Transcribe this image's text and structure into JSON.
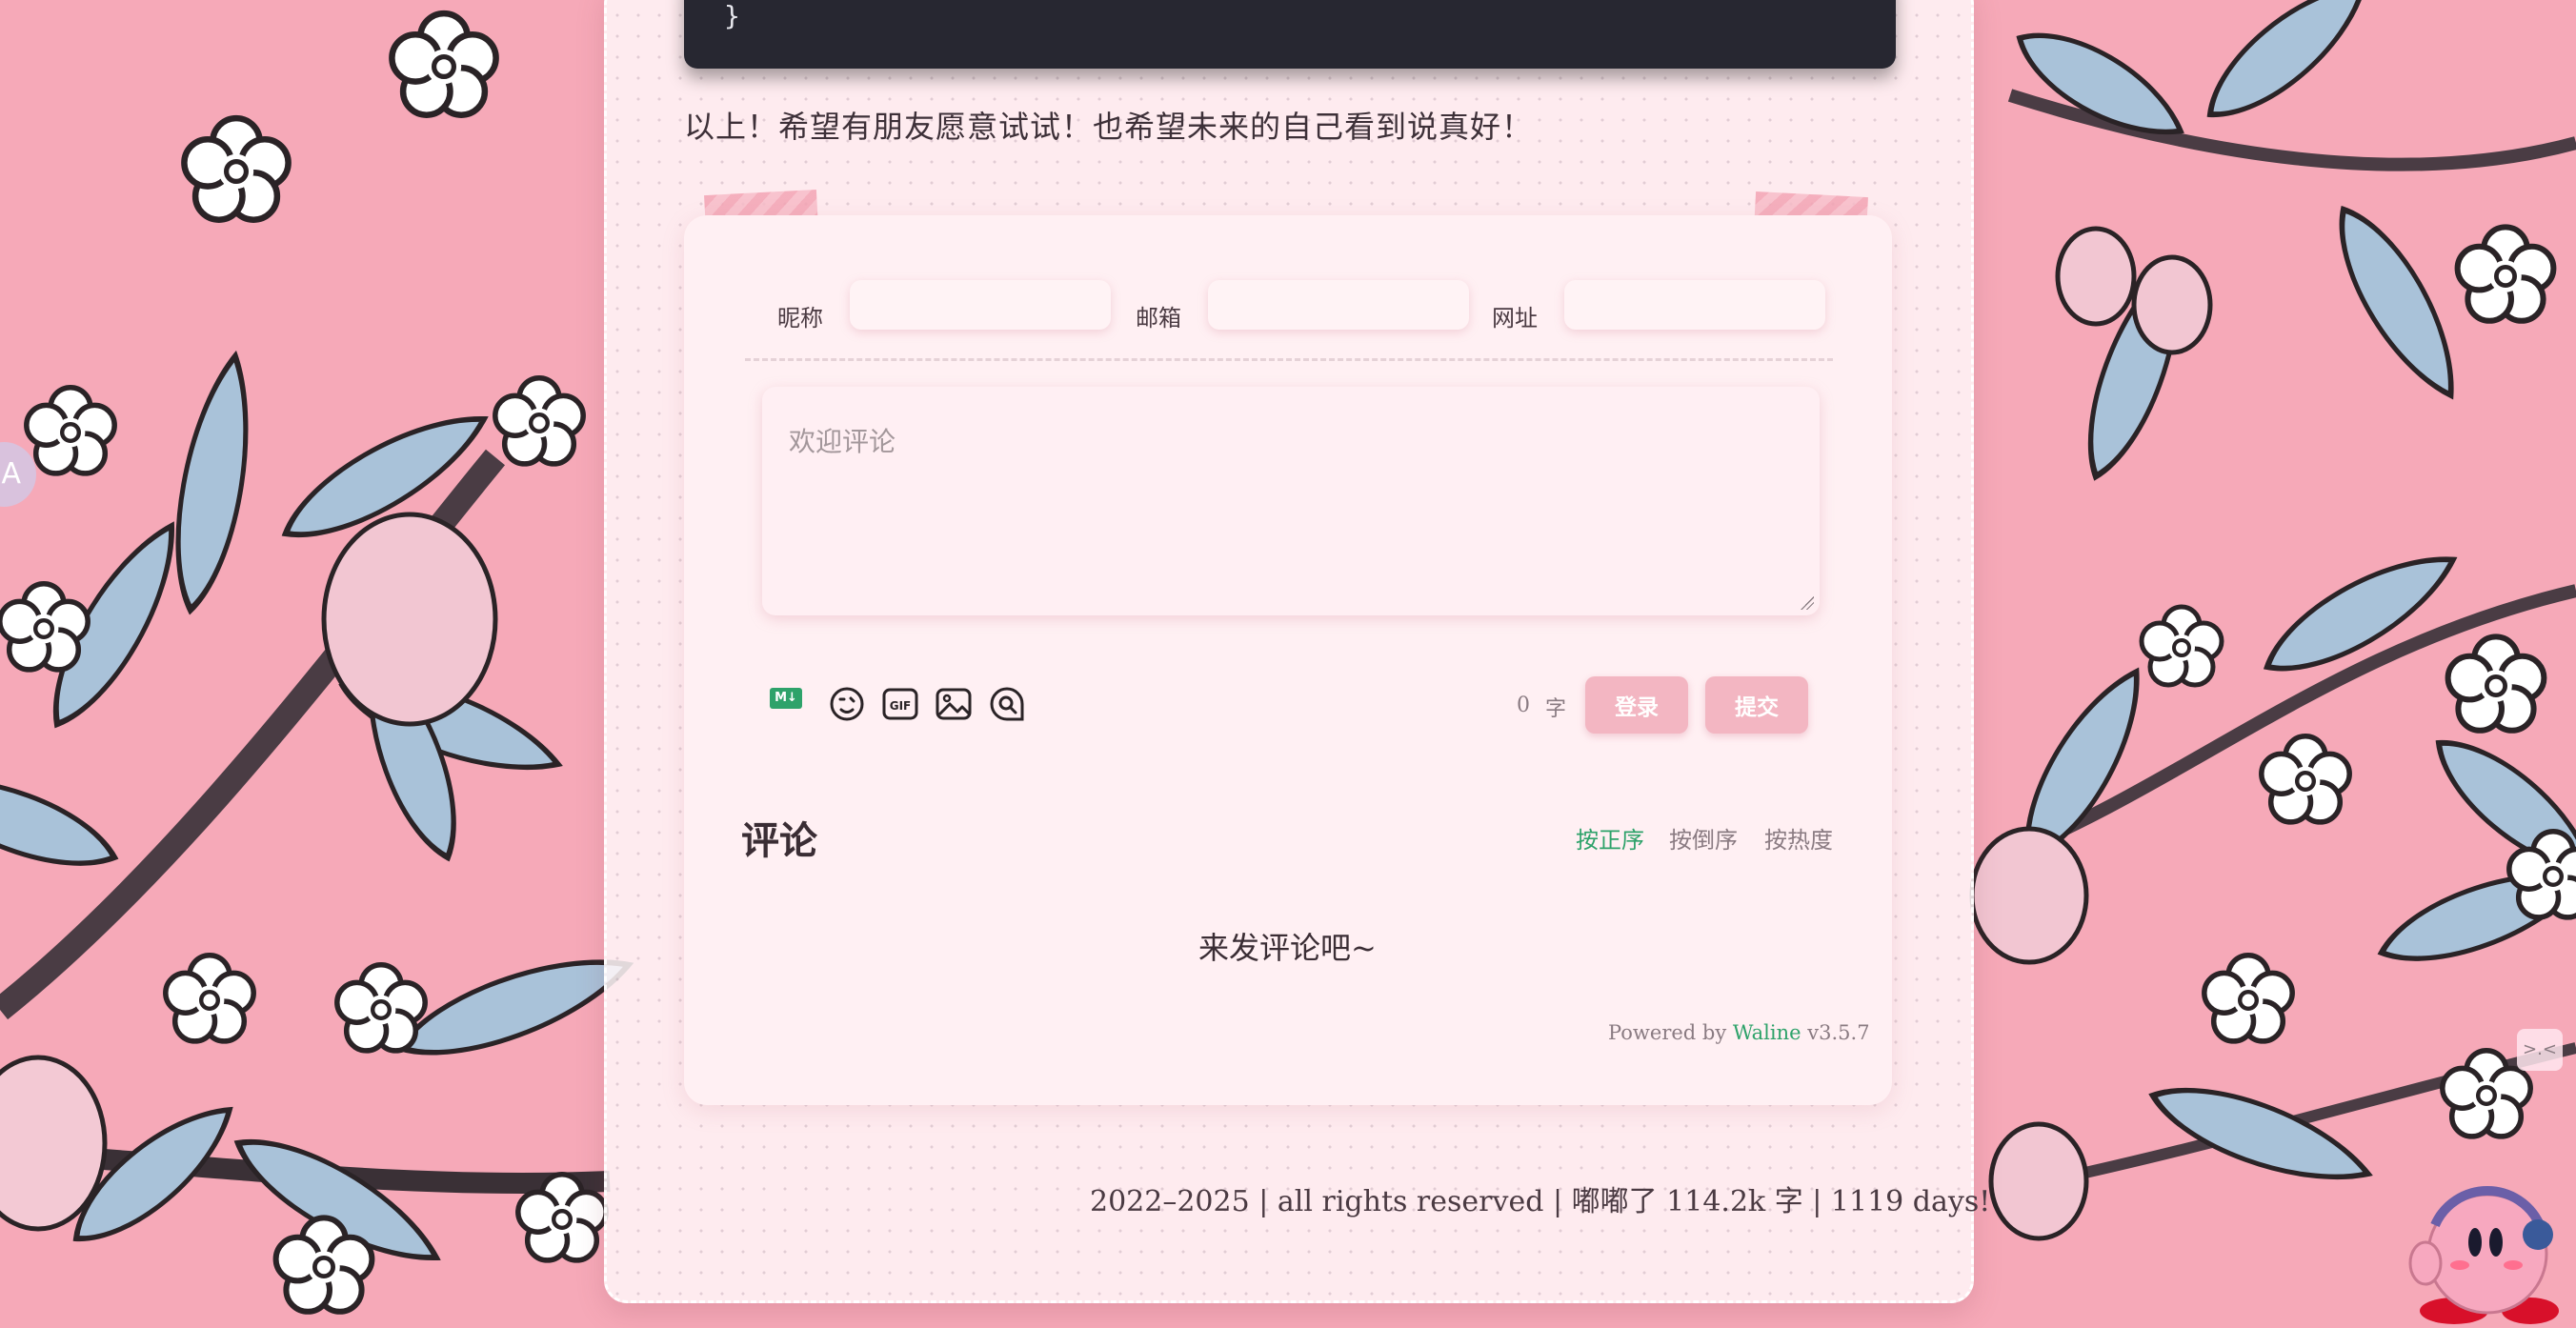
{
  "code_block": {
    "closing_brace": "}"
  },
  "article": {
    "closing_text": "以上！希望有朋友愿意试试！也希望未来的自己看到说真好！"
  },
  "comment_form": {
    "nick_label": "昵称",
    "mail_label": "邮箱",
    "link_label": "网址",
    "textarea_placeholder": "欢迎评论",
    "markdown_icon_text": "M↓",
    "word_count": "0",
    "word_unit": "字",
    "login_button": "登录",
    "submit_button": "提交",
    "icons": [
      "markdown-icon",
      "emoji-icon",
      "gif-icon",
      "image-icon",
      "preview-icon"
    ]
  },
  "comments": {
    "title": "评论",
    "sort_options": [
      "按正序",
      "按倒序",
      "按热度"
    ],
    "empty_message": "来发评论吧~",
    "powered_by_prefix": "Powered by",
    "powered_by_link": "Waline",
    "powered_by_version": "v3.5.7"
  },
  "footer": {
    "text": "2022–2025 | all rights reserved | 嘟嘟了 114.2k 字 | 1119 days!"
  },
  "floating": {
    "left_button": "A",
    "emote_button": ">.<"
  },
  "colors": {
    "accent_green": "#2ea26a",
    "button_pink": "#f3b6c2",
    "page_pink": "#f6a9b8",
    "code_bg": "#272731"
  }
}
